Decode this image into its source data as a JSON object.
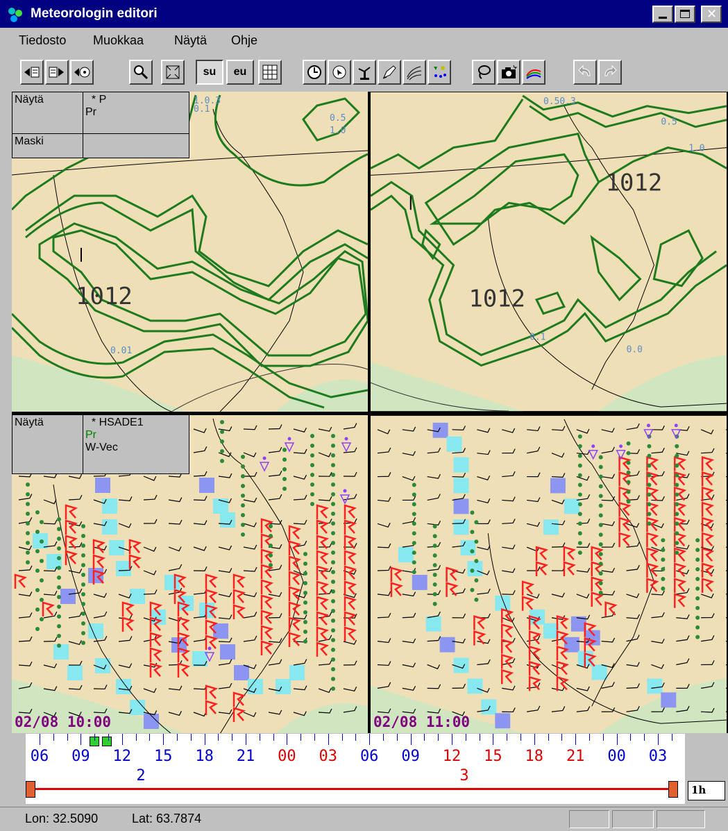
{
  "window": {
    "title": "Meteorologin editori"
  },
  "menu": {
    "items": [
      {
        "label": "Tiedosto",
        "accel": "T"
      },
      {
        "label": "Muokkaa",
        "accel": "M"
      },
      {
        "label": "Näytä",
        "accel": "N"
      },
      {
        "label": "Ohje",
        "accel": "O"
      }
    ]
  },
  "toolbar": {
    "su_label": "su",
    "eu_label": "eu"
  },
  "panels": {
    "top_overlay": {
      "show_label": "Näytä",
      "params": "* P\nPr",
      "param_lines": [
        "  * P",
        "Pr"
      ],
      "mask_label": "Maski"
    },
    "bottom_overlay": {
      "show_label": "Näytä",
      "param_lines": [
        "  * HSADE1",
        "Pr",
        "W-Vec"
      ]
    },
    "top_left": {
      "labels": [
        "1.0.3",
        "0.1",
        "0.5",
        "1.0",
        "1012",
        "0.01"
      ]
    },
    "top_right": {
      "labels": [
        "0.50.3",
        "0.5",
        "1.0",
        "1012",
        "1012",
        "0.0",
        "0.1"
      ]
    },
    "bottom_left": {
      "timestamp": "02/08 10:00"
    },
    "bottom_right": {
      "timestamp": "02/08 11:00"
    }
  },
  "timeline": {
    "hour_ticks": [
      "06",
      "09",
      "12",
      "15",
      "18",
      "21",
      "00",
      "03",
      "06",
      "09",
      "12",
      "15",
      "18",
      "21",
      "00",
      "03"
    ],
    "day_labels": [
      "2",
      "3"
    ],
    "step_label": "1h"
  },
  "status": {
    "lon": "Lon: 32.5090",
    "lat": "Lat: 63.7874"
  },
  "colors": {
    "title_bg": "#000080",
    "contour": "#1e7a1e",
    "map_land": "#eedfb6",
    "map_sea": "#c8e6c0",
    "precip_light": "#87e8f0",
    "precip_heavy": "#8c96f0",
    "wind_red": "#ff2020",
    "timestamp": "#800080",
    "timeline_day1": "#0000cc",
    "timeline_day2": "#dd0000"
  }
}
